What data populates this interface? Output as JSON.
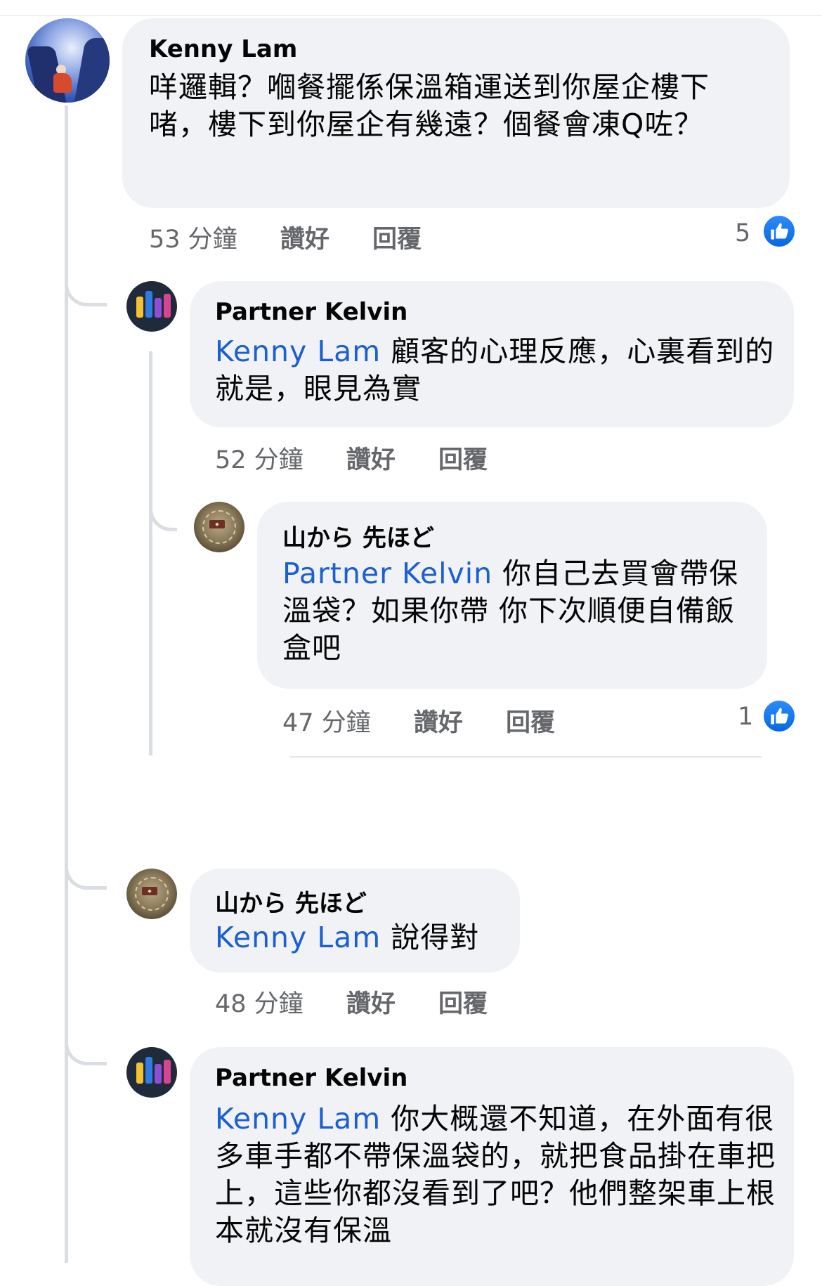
{
  "comments": [
    {
      "author": "Kenny Lam",
      "text": "咩邏輯？嗰餐擺係保溫箱運送到你屋企樓下啫，樓下到你屋企有幾遠？個餐會凍Q咗？",
      "mention": "",
      "time": "53 分鐘",
      "like_label": "讚好",
      "reply_label": "回覆",
      "like_count": "5"
    },
    {
      "author": "Partner Kelvin",
      "mention": "Kenny Lam",
      "text": " 顧客的心理反應，心裏看到的就是，眼見為實",
      "time": "52 分鐘",
      "like_label": "讚好",
      "reply_label": "回覆"
    },
    {
      "author": "山から 先ほど",
      "mention": "Partner Kelvin",
      "text": " 你自己去買會帶保溫袋？如果你帶 你下次順便自備飯盒吧",
      "time": "47 分鐘",
      "like_label": "讚好",
      "reply_label": "回覆",
      "like_count": "1"
    },
    {
      "author": "山から 先ほど",
      "mention": "Kenny Lam",
      "text": " 說得對",
      "time": "48 分鐘",
      "like_label": "讚好",
      "reply_label": "回覆"
    },
    {
      "author": "Partner Kelvin",
      "mention": "Kenny Lam",
      "text": " 你大概還不知道，在外面有很多車手都不帶保溫袋的，就把食品掛在車把上，這些你都沒看到了吧？他們整架車上根本就沒有保溫"
    }
  ],
  "icons": {
    "like": "thumbs-up-icon"
  },
  "colors": {
    "bubble": "#f0f2f5",
    "mention": "#1b5fd1",
    "like_badge": "#1877f2",
    "meta": "#65676b"
  }
}
